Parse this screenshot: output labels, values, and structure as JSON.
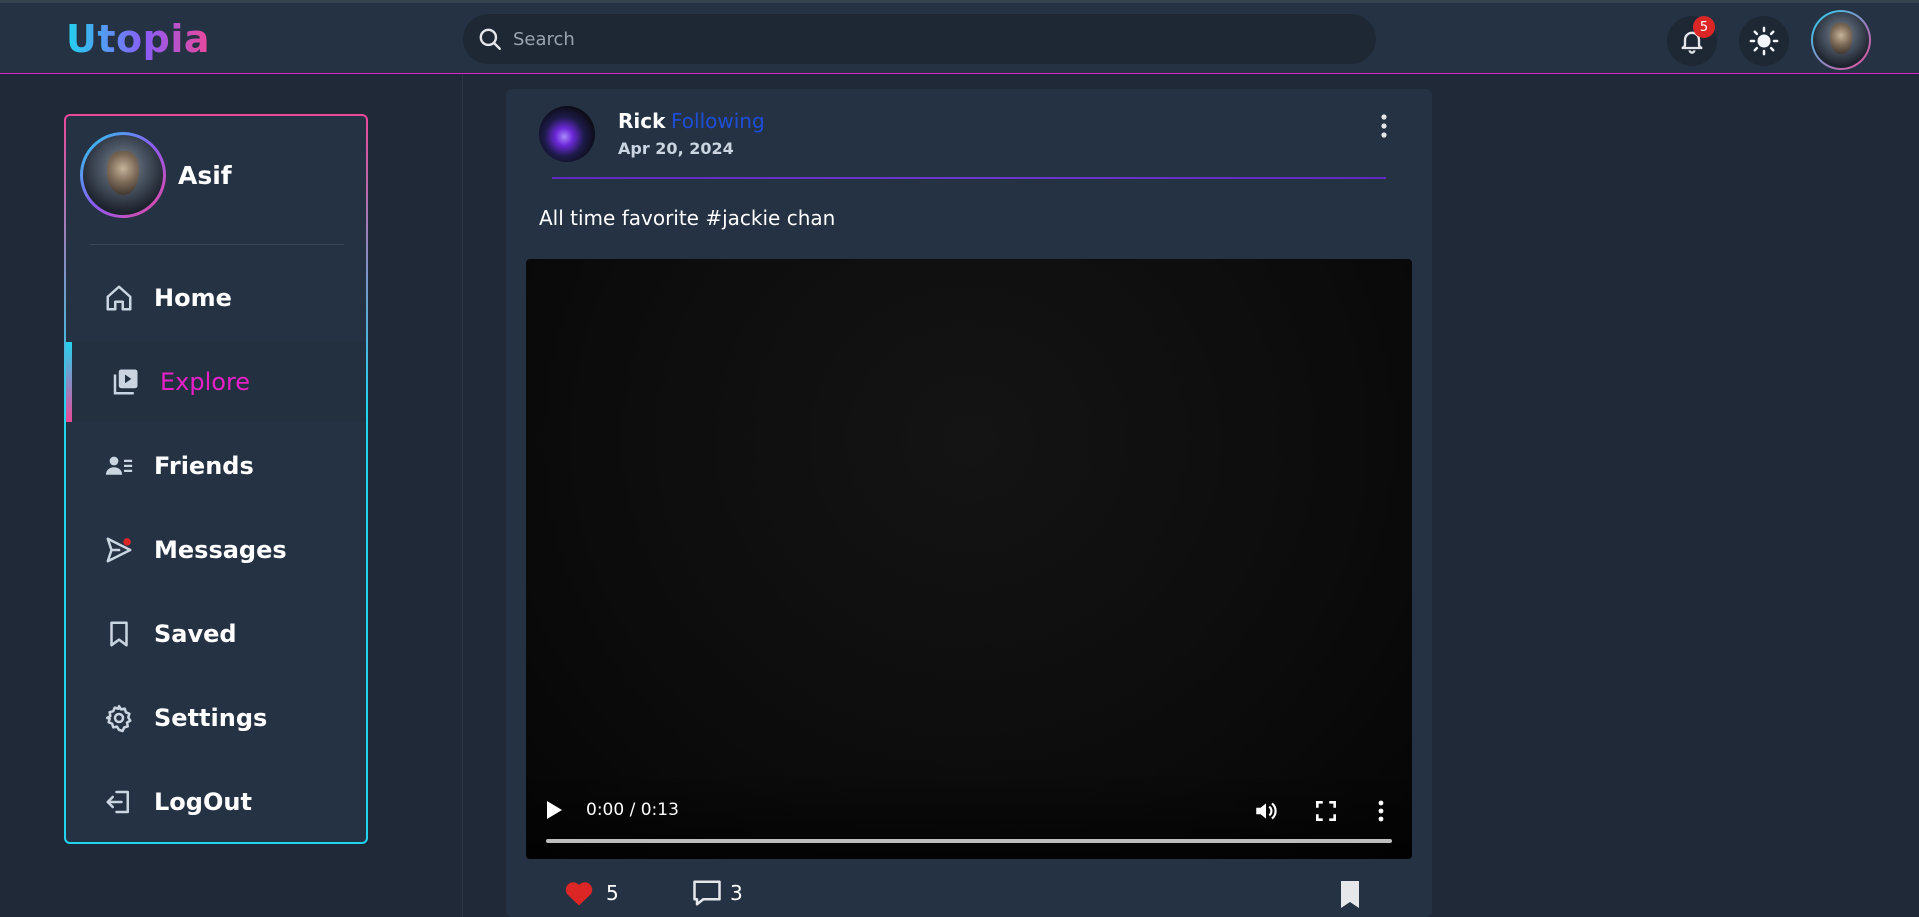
{
  "header": {
    "logo": "Utopia",
    "search_placeholder": "Search",
    "notification_count": "5",
    "theme_toggle_icon": "sun-icon"
  },
  "sidebar": {
    "profile_name": "Asif",
    "items": [
      {
        "label": "Home",
        "icon": "home-icon"
      },
      {
        "label": "Explore",
        "icon": "video-library-icon",
        "active": true
      },
      {
        "label": "Friends",
        "icon": "friends-icon"
      },
      {
        "label": "Messages",
        "icon": "messages-icon"
      },
      {
        "label": "Saved",
        "icon": "bookmark-icon"
      },
      {
        "label": "Settings",
        "icon": "gear-icon"
      },
      {
        "label": "LogOut",
        "icon": "logout-icon"
      }
    ]
  },
  "post": {
    "author": "Rick",
    "follow_status": "Following",
    "date": "Apr 20, 2024",
    "caption": "All time favorite #jackie chan",
    "video": {
      "time": "0:00 / 0:13"
    },
    "likes": "5",
    "comments": "3"
  },
  "colors": {
    "accent_pink": "#e91fc9",
    "accent_cyan": "#22d3ee",
    "following_blue": "#1d4ed8",
    "like_red": "#dc2626"
  }
}
